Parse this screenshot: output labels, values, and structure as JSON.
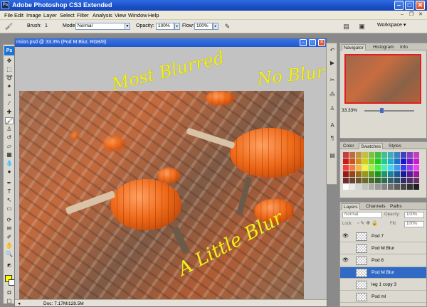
{
  "window": {
    "title": "Adobe Photoshop CS3 Extended",
    "app_icon": "Ps"
  },
  "menu": [
    "File",
    "Edit",
    "Image",
    "Layer",
    "Select",
    "Filter",
    "Analysis",
    "View",
    "Window",
    "Help"
  ],
  "options": {
    "brush_label": "Brush:",
    "brush_size": "1",
    "mode_label": "Mode:",
    "mode_value": "Normal",
    "opacity_label": "Opacity:",
    "opacity_value": "100%",
    "flow_label": "Flow:",
    "flow_value": "100%",
    "workspace_label": "Workspace ▾"
  },
  "toolbox": {
    "logo": "Ps"
  },
  "document": {
    "title": "nsion.psd @ 33.3% (Pod M Blur, RGB/8)",
    "status": "Doc: 7.17M/128.5M"
  },
  "annotations": {
    "most_blurred": "Most Blurred",
    "no_blur": "No Blur",
    "a_little_blur": "A Little Blur"
  },
  "navigator": {
    "tabs": [
      "Navigator",
      "Histogram",
      "Info"
    ],
    "zoom": "33.33%"
  },
  "swatches": {
    "tabs": [
      "Color",
      "Swatches",
      "Styles"
    ]
  },
  "layers": {
    "tabs": [
      "Layers",
      "Channels",
      "Paths"
    ],
    "blend_mode": "Normal",
    "opacity_label": "Opacity:",
    "opacity": "100%",
    "lock_label": "Lock:",
    "fill_label": "Fill:",
    "fill": "100%",
    "rows": [
      {
        "name": "Pod 7",
        "visible": true,
        "selected": false
      },
      {
        "name": "Pod M Blur",
        "visible": false,
        "selected": false
      },
      {
        "name": "Pod 8",
        "visible": true,
        "selected": false
      },
      {
        "name": "Pod M Blur",
        "visible": false,
        "selected": true
      },
      {
        "name": "leg 1 copy 3",
        "visible": false,
        "selected": false
      },
      {
        "name": "Pod ml",
        "visible": false,
        "selected": false
      }
    ]
  },
  "colors": {
    "accent": "#316ac5",
    "annotation": "#f3ef1e",
    "foreground": "#ffff00",
    "background": "#ffffff"
  }
}
